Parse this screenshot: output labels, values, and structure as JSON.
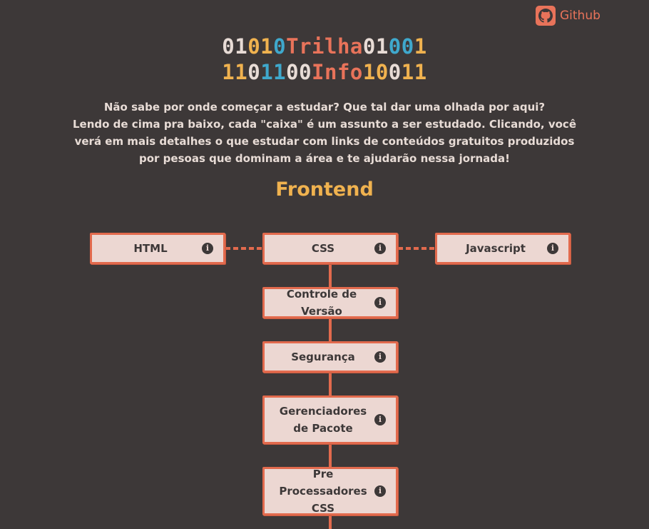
{
  "header": {
    "github_label": "Github"
  },
  "logo": {
    "line1": [
      {
        "t": "01",
        "c": "#e8dcd6"
      },
      {
        "t": "01",
        "c": "#f0b24f"
      },
      {
        "t": "0",
        "c": "#3fa8cc"
      },
      {
        "t": "Trilha",
        "c": "#e8735a"
      },
      {
        "t": "01",
        "c": "#e8dcd6"
      },
      {
        "t": "00",
        "c": "#3fa8cc"
      },
      {
        "t": "1",
        "c": "#f0b24f"
      }
    ],
    "line2": [
      {
        "t": "11",
        "c": "#f0b24f"
      },
      {
        "t": "0",
        "c": "#e8dcd6"
      },
      {
        "t": "11",
        "c": "#3fa8cc"
      },
      {
        "t": "00",
        "c": "#e8dcd6"
      },
      {
        "t": "Info",
        "c": "#e8735a"
      },
      {
        "t": "10",
        "c": "#f0b24f"
      },
      {
        "t": "0",
        "c": "#e8dcd6"
      },
      {
        "t": "11",
        "c": "#f0b24f"
      }
    ]
  },
  "intro": {
    "line1": "Não sabe por onde começar a estudar? Que tal dar uma olhada por aqui?",
    "line2": "Lendo de cima pra baixo, cada \"caixa\" é um assunto a ser estudado. Clicando, você verá em mais detalhes o que estudar com links de conteúdos gratuitos produzidos por pesoas que dominam a área e te ajudarão nessa jornada!"
  },
  "section": {
    "title": "Frontend"
  },
  "nodes": {
    "html": "HTML",
    "css": "CSS",
    "javascript": "Javascript",
    "version_control": "Controle de Versão",
    "security": "Segurança",
    "package_managers": "Gerenciadores de Pacote",
    "css_preprocessors": "Pre Processadores CSS"
  },
  "icons": {
    "info": "info-icon",
    "github": "github-icon"
  },
  "colors": {
    "background": "#3d3838",
    "accent": "#e26a4d",
    "title": "#f0b24f",
    "box": "#ecd7d2"
  }
}
